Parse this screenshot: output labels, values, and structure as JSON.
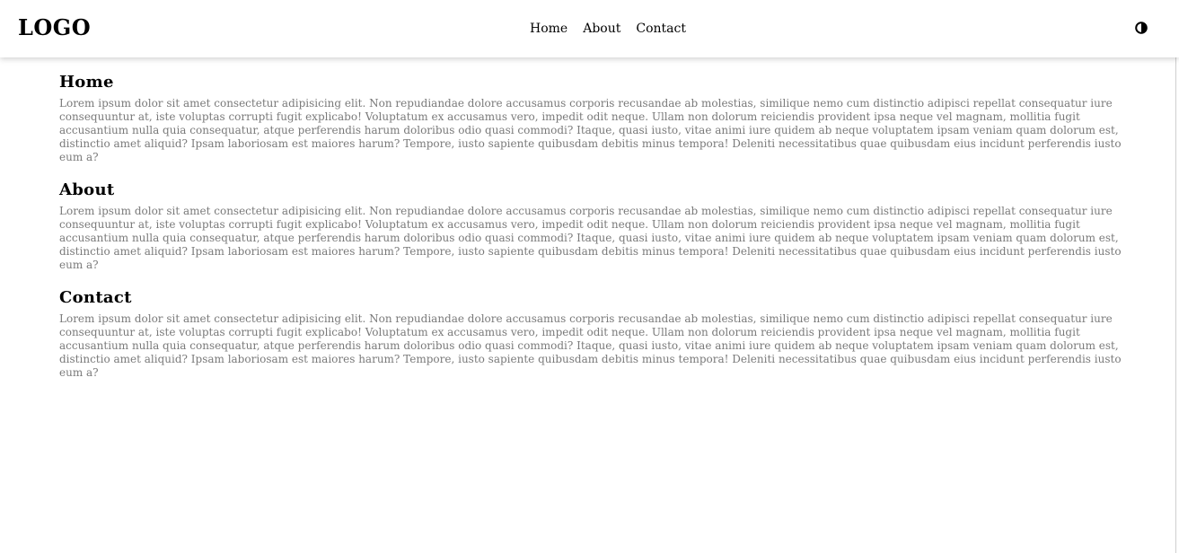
{
  "header": {
    "logo": "LOGO",
    "nav": [
      {
        "label": "Home"
      },
      {
        "label": "About"
      },
      {
        "label": "Contact"
      }
    ],
    "theme_toggle_icon": "half-circle-contrast-icon"
  },
  "sections": [
    {
      "title": "Home",
      "text": "Lorem ipsum dolor sit amet consectetur adipisicing elit. Non repudiandae dolore accusamus corporis recusandae ab molestias, similique nemo cum distinctio adipisci repellat consequatur iure consequuntur at, iste voluptas corrupti fugit explicabo! Voluptatum ex accusamus vero, impedit odit neque. Ullam non dolorum reiciendis provident ipsa neque vel magnam, mollitia fugit accusantium nulla quia consequatur, atque perferendis harum doloribus odio quasi commodi? Itaque, quasi iusto, vitae animi iure quidem ab neque voluptatem ipsam veniam quam dolorum est, distinctio amet aliquid? Ipsam laboriosam est maiores harum? Tempore, iusto sapiente quibusdam debitis minus tempora! Deleniti necessitatibus quae quibusdam eius incidunt perferendis iusto eum a?"
    },
    {
      "title": "About",
      "text": "Lorem ipsum dolor sit amet consectetur adipisicing elit. Non repudiandae dolore accusamus corporis recusandae ab molestias, similique nemo cum distinctio adipisci repellat consequatur iure consequuntur at, iste voluptas corrupti fugit explicabo! Voluptatum ex accusamus vero, impedit odit neque. Ullam non dolorum reiciendis provident ipsa neque vel magnam, mollitia fugit accusantium nulla quia consequatur, atque perferendis harum doloribus odio quasi commodi? Itaque, quasi iusto, vitae animi iure quidem ab neque voluptatem ipsam veniam quam dolorum est, distinctio amet aliquid? Ipsam laboriosam est maiores harum? Tempore, iusto sapiente quibusdam debitis minus tempora! Deleniti necessitatibus quae quibusdam eius incidunt perferendis iusto eum a?"
    },
    {
      "title": "Contact",
      "text": "Lorem ipsum dolor sit amet consectetur adipisicing elit. Non repudiandae dolore accusamus corporis recusandae ab molestias, similique nemo cum distinctio adipisci repellat consequatur iure consequuntur at, iste voluptas corrupti fugit explicabo! Voluptatum ex accusamus vero, impedit odit neque. Ullam non dolorum reiciendis provident ipsa neque vel magnam, mollitia fugit accusantium nulla quia consequatur, atque perferendis harum doloribus odio quasi commodi? Itaque, quasi iusto, vitae animi iure quidem ab neque voluptatem ipsam veniam quam dolorum est, distinctio amet aliquid? Ipsam laboriosam est maiores harum? Tempore, iusto sapiente quibusdam debitis minus tempora! Deleniti necessitatibus quae quibusdam eius incidunt perferendis iusto eum a?"
    }
  ],
  "colors": {
    "text_primary": "#000000",
    "text_muted": "#7a7a7a",
    "background": "#ffffff"
  }
}
